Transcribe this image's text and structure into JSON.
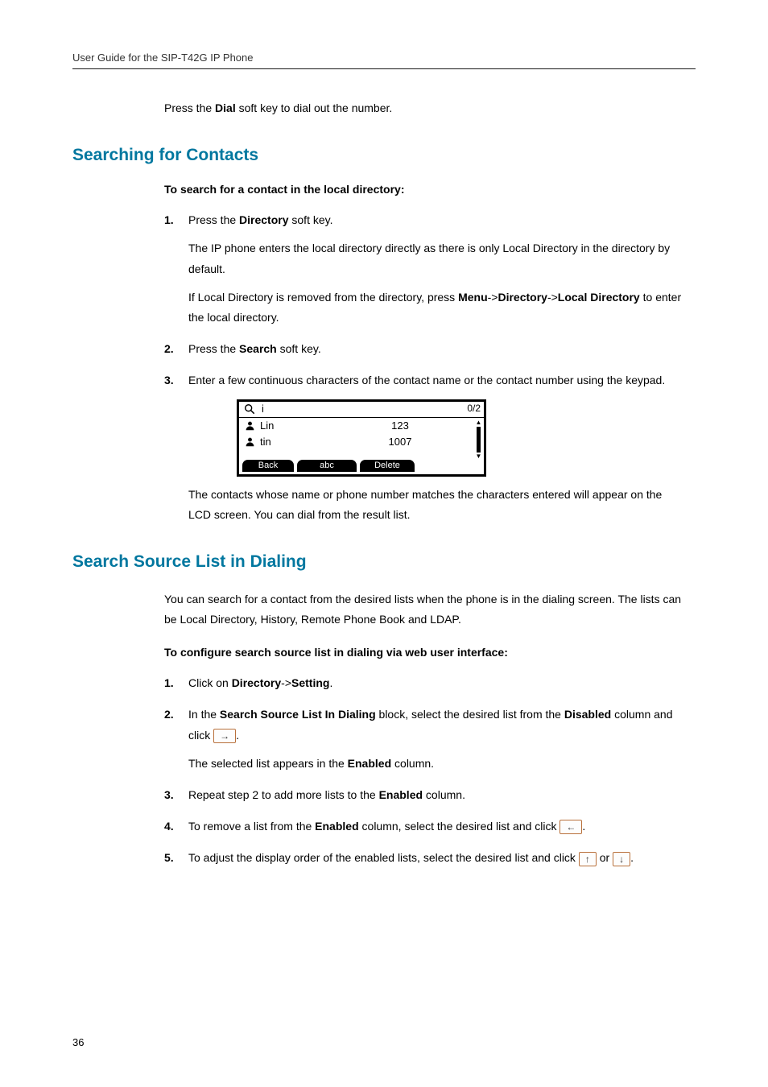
{
  "header": {
    "title": "User Guide for the SIP-T42G IP Phone"
  },
  "intro": {
    "press_dial_pre": "Press the ",
    "press_dial_b": "Dial",
    "press_dial_post": " soft key to dial out the number."
  },
  "searching": {
    "heading": "Searching for Contacts",
    "subhead": "To search for a contact in the local directory:",
    "s1_pre": "Press the ",
    "s1_b": "Directory",
    "s1_post": " soft key.",
    "s1_p1": "The IP phone enters the local directory directly as there is only Local Directory in the directory by default.",
    "s1_p2_pre": "If Local Directory is removed from the directory, press ",
    "s1_p2_b1": "Menu",
    "s1_p2_m1": "->",
    "s1_p2_b2": "Directory",
    "s1_p2_m2": "->",
    "s1_p2_b3": "Local Directory",
    "s1_p2_post": " to enter the local directory.",
    "s2_pre": "Press the ",
    "s2_b": "Search",
    "s2_post": " soft key.",
    "s3": "Enter a few continuous characters of the contact name or the contact number using the keypad.",
    "after_fig": "The contacts whose name or phone number matches the characters entered will appear on the LCD screen. You can dial from the result list."
  },
  "lcd": {
    "search_text": "i",
    "count": "0/2",
    "rows": [
      {
        "name": "Lin",
        "num": "123"
      },
      {
        "name": "tin",
        "num": "1007"
      }
    ],
    "sk1": "Back",
    "sk2": "abc",
    "sk3": "Delete"
  },
  "dialing": {
    "heading": "Search Source List in Dialing",
    "intro": "You can search for a contact from the desired lists when the phone is in the dialing screen. The lists can be Local Directory, History, Remote Phone Book and LDAP.",
    "subhead": "To configure search source list in dialing via web user interface:",
    "s1_pre": "Click on ",
    "s1_b1": "Directory",
    "s1_m": "->",
    "s1_b2": "Setting",
    "s1_post": ".",
    "s2_pre": "In the ",
    "s2_b1": "Search Source List In Dialing",
    "s2_mid": " block, select the desired list from the ",
    "s2_b2": "Disabled",
    "s2_after": " column and click ",
    "s2_btn": "→",
    "s2_post": ".",
    "s2_p1_pre": "The selected list appears in the ",
    "s2_p1_b": "Enabled",
    "s2_p1_post": " column.",
    "s3_pre": "Repeat step 2 to add more lists to the ",
    "s3_b": "Enabled",
    "s3_post": " column.",
    "s4_pre": "To remove a list from the ",
    "s4_b": "Enabled",
    "s4_mid": " column, select the desired list and click ",
    "s4_btn": "←",
    "s4_post": ".",
    "s5_pre": "To adjust the display order of the enabled lists, select the desired list and click ",
    "s5_btn1": "↑",
    "s5_or": " or ",
    "s5_btn2": "↓",
    "s5_post": "."
  },
  "footer": {
    "page": "36"
  }
}
